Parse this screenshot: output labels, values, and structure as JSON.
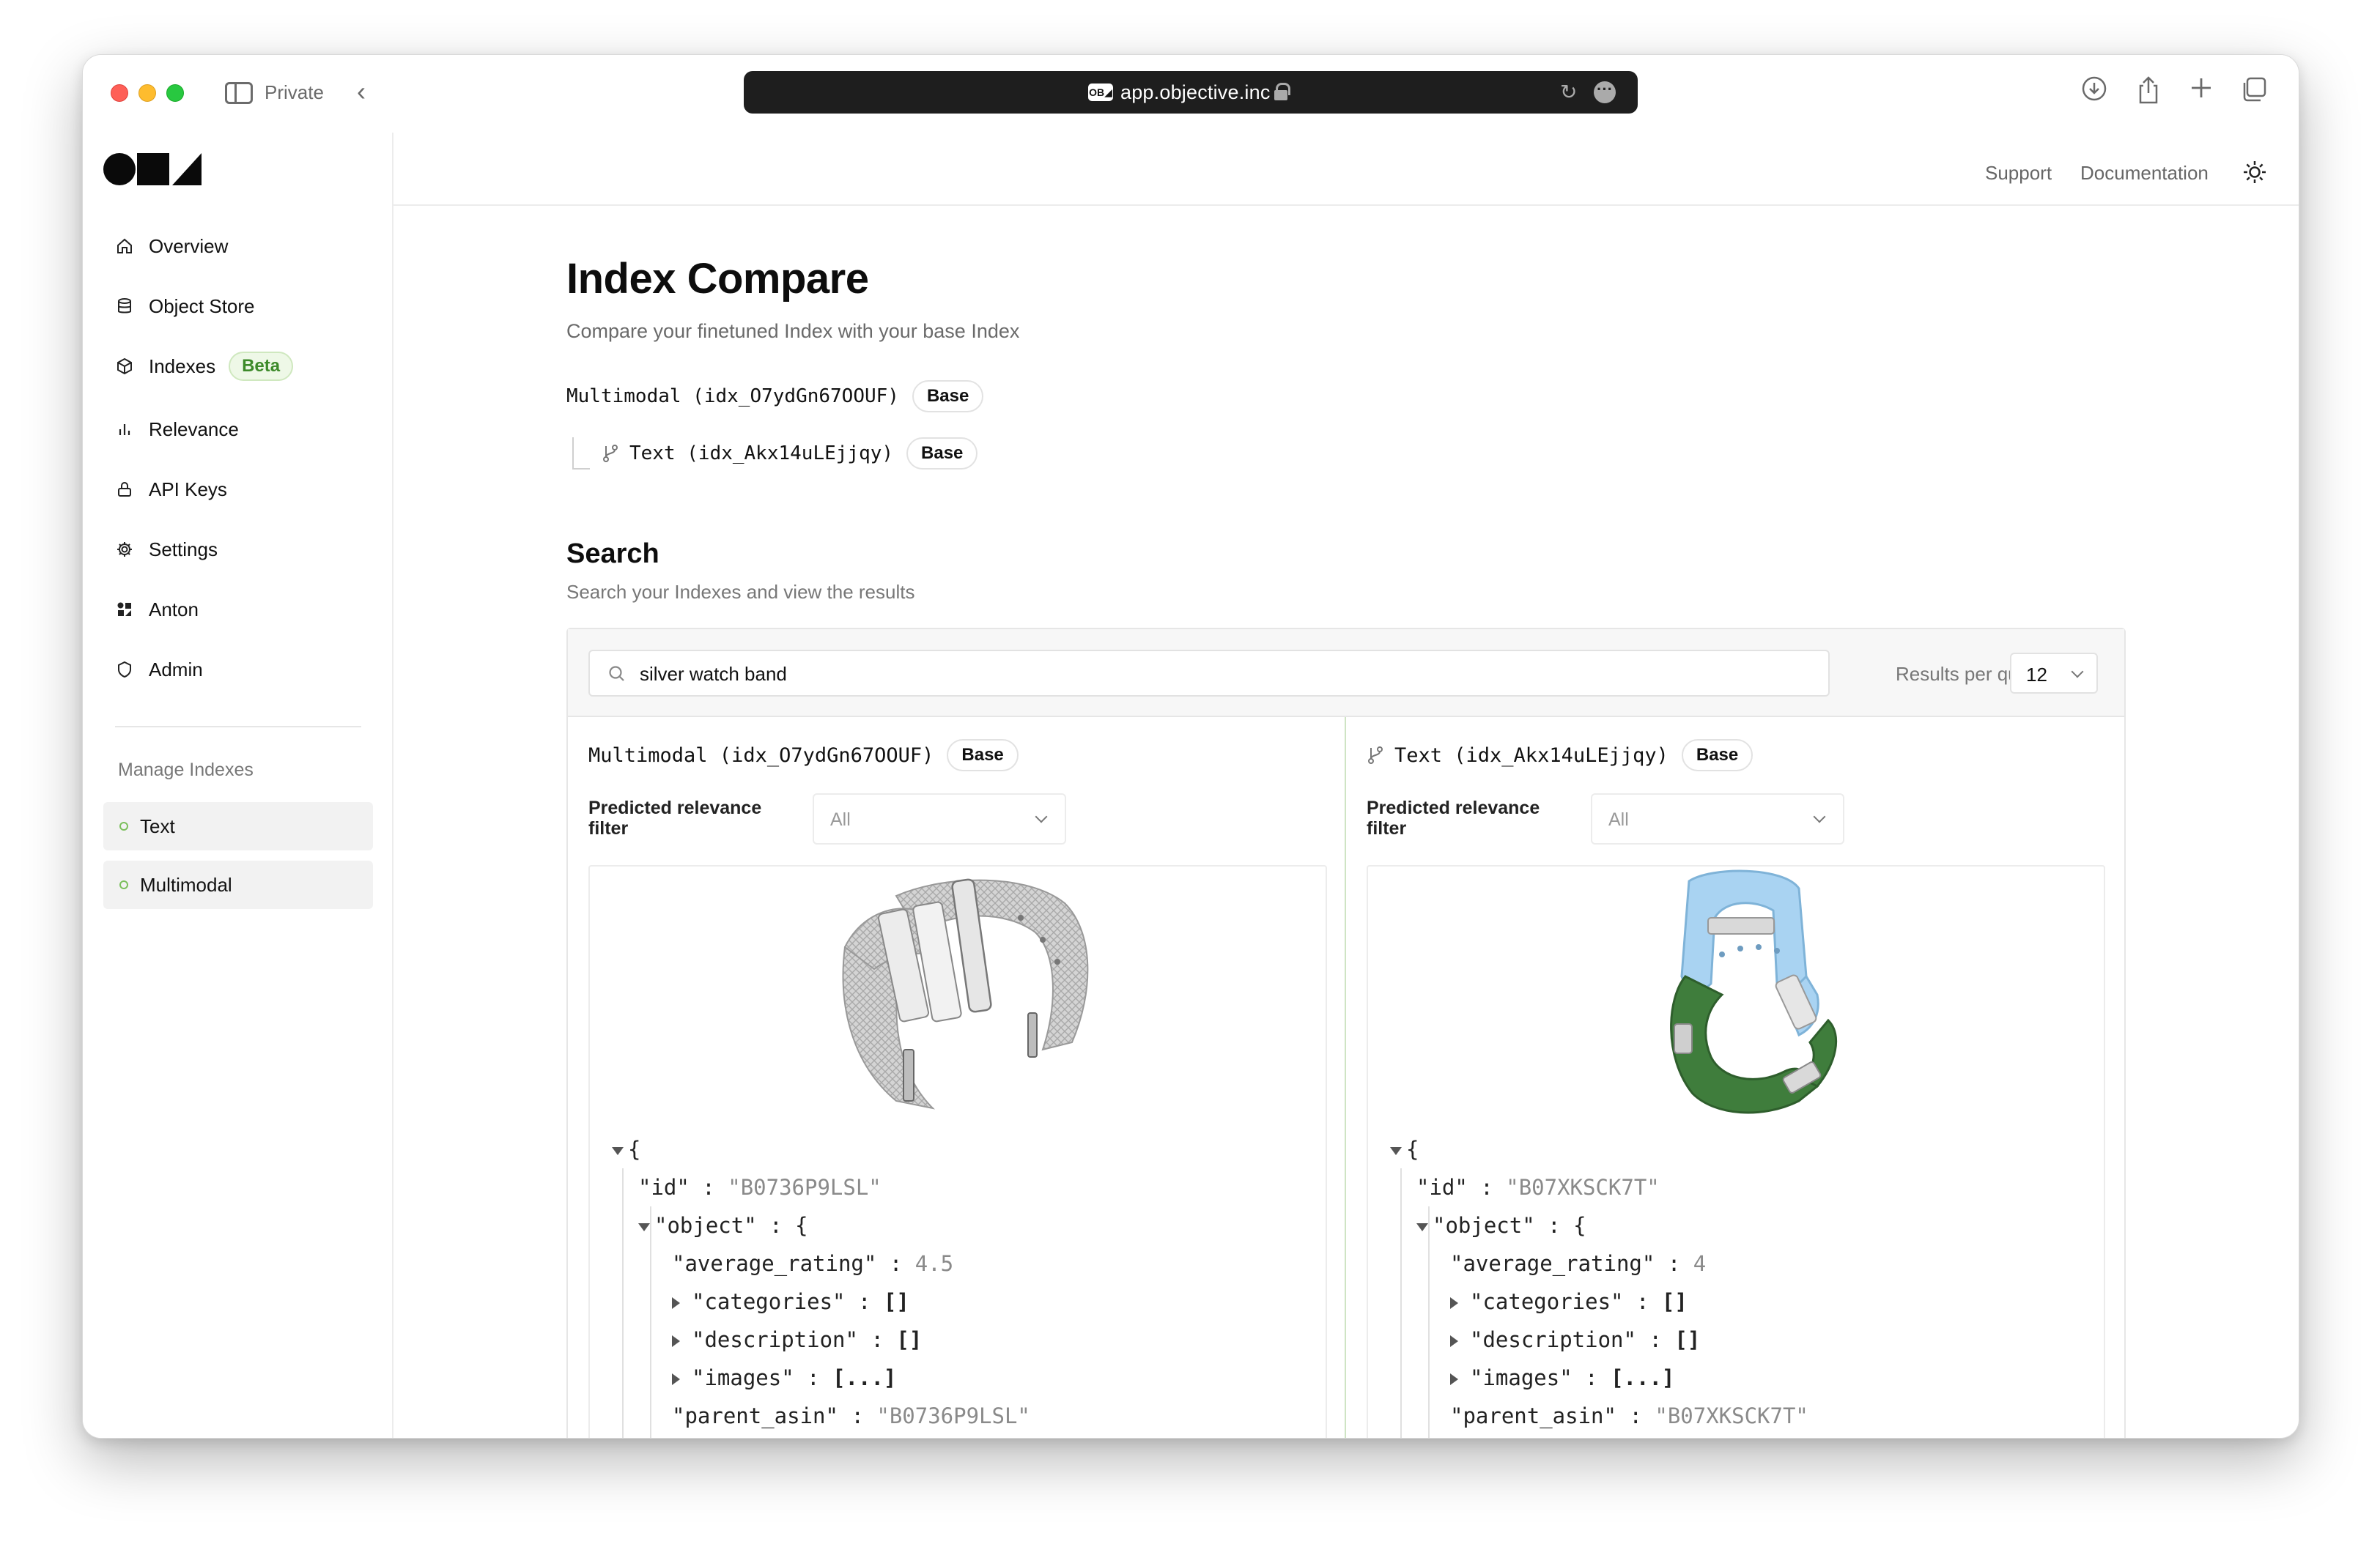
{
  "browser": {
    "private_label": "Private",
    "url": "app.objective.inc",
    "favicon_text": "OB◢"
  },
  "sidebar": {
    "nav": [
      {
        "label": "Overview",
        "icon": "home-icon"
      },
      {
        "label": "Object Store",
        "icon": "database-icon"
      },
      {
        "label": "Indexes",
        "icon": "cube-icon",
        "badge": "Beta"
      },
      {
        "label": "Relevance",
        "icon": "bar-chart-icon"
      },
      {
        "label": "API Keys",
        "icon": "lock-icon"
      },
      {
        "label": "Settings",
        "icon": "gear-icon"
      },
      {
        "label": "Anton",
        "icon": "anton-icon"
      },
      {
        "label": "Admin",
        "icon": "shield-icon"
      }
    ],
    "section_title": "Manage Indexes",
    "indexes": [
      {
        "label": "Text"
      },
      {
        "label": "Multimodal"
      }
    ]
  },
  "topbar": {
    "support": "Support",
    "documentation": "Documentation"
  },
  "page": {
    "title": "Index Compare",
    "subtitle": "Compare your finetuned Index with your base Index",
    "base_index": {
      "name": "Multimodal (idx_O7ydGn67OOUF)",
      "badge": "Base"
    },
    "child_index": {
      "name": "Text (idx_Akx14uLEjjqy)",
      "badge": "Base"
    }
  },
  "search": {
    "title": "Search",
    "subtitle": "Search your Indexes and view the results",
    "query": "silver watch band",
    "results_label": "Results per query",
    "results_value": "12"
  },
  "columns": [
    {
      "index_name": "Multimodal (idx_O7ydGn67OOUF)",
      "badge": "Base",
      "filter_label": "Predicted relevance filter",
      "filter_value": "All",
      "result": {
        "open_brace": "{",
        "id_key": "\"id\"",
        "id_value": "\"B0736P9LSL\"",
        "object_key": "\"object\"",
        "rating_key": "\"average_rating\"",
        "rating_value": "4.5",
        "categories_key": "\"categories\"",
        "categories_value": "[]",
        "description_key": "\"description\"",
        "description_value": "[]",
        "images_key": "\"images\"",
        "images_value": "[...]",
        "parent_key": "\"parent_asin\"",
        "parent_value": "\"B0736P9LSL\""
      }
    },
    {
      "index_name": "Text (idx_Akx14uLEjjqy)",
      "badge": "Base",
      "filter_label": "Predicted relevance filter",
      "filter_value": "All",
      "result": {
        "open_brace": "{",
        "id_key": "\"id\"",
        "id_value": "\"B07XKSCK7T\"",
        "object_key": "\"object\"",
        "rating_key": "\"average_rating\"",
        "rating_value": "4",
        "categories_key": "\"categories\"",
        "categories_value": "[]",
        "description_key": "\"description\"",
        "description_value": "[]",
        "images_key": "\"images\"",
        "images_value": "[...]",
        "parent_key": "\"parent_asin\"",
        "parent_value": "\"B07XKSCK7T\""
      }
    }
  ],
  "colors": {
    "accent_green": "#7bbf5c",
    "beta_text": "#3d8a2a",
    "watch_band_left": "#c9c9c9",
    "watch_band_right_top": "#a9d3f2",
    "watch_band_right_bottom": "#3f7d3c"
  }
}
